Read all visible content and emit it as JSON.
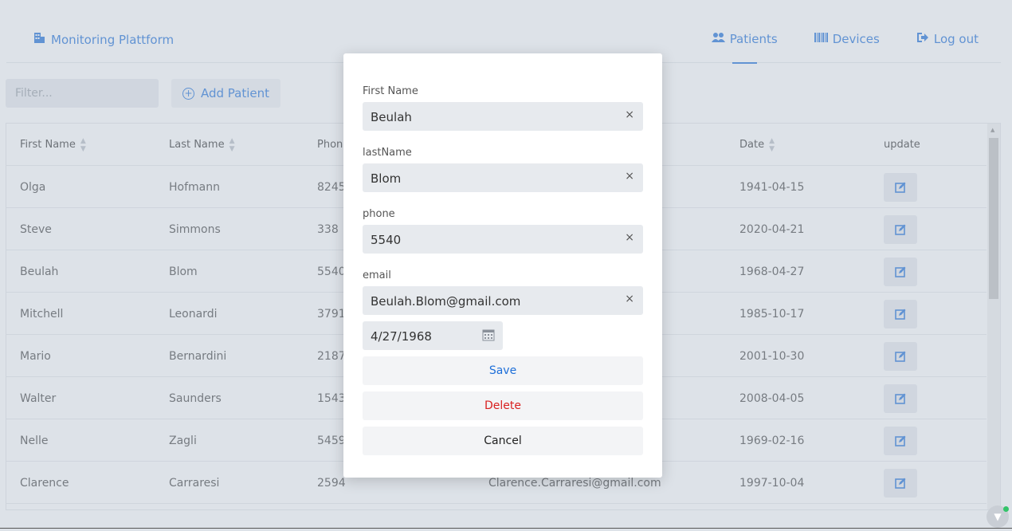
{
  "header": {
    "brand": "Monitoring Plattform",
    "nav": [
      {
        "label": "Patients",
        "icon": "users-icon"
      },
      {
        "label": "Devices",
        "icon": "barcode-icon"
      },
      {
        "label": "Log out",
        "icon": "logout-icon"
      }
    ]
  },
  "toolbar": {
    "filter_placeholder": "Filter...",
    "add_label": "Add Patient"
  },
  "table": {
    "columns": [
      "First Name",
      "Last Name",
      "Phon",
      "Date",
      "update"
    ],
    "rows": [
      {
        "first": "Olga",
        "last": "Hofmann",
        "phone": "8245",
        "date": "1941-04-15"
      },
      {
        "first": "Steve",
        "last": "Simmons",
        "phone": "338",
        "date": "2020-04-21"
      },
      {
        "first": "Beulah",
        "last": "Blom",
        "phone": "5540",
        "date": "1968-04-27"
      },
      {
        "first": "Mitchell",
        "last": "Leonardi",
        "phone": "3791",
        "date": "1985-10-17"
      },
      {
        "first": "Mario",
        "last": "Bernardini",
        "phone": "2187",
        "date": "2001-10-30"
      },
      {
        "first": "Walter",
        "last": "Saunders",
        "phone": "1543",
        "date": "2008-04-05"
      },
      {
        "first": "Nelle",
        "last": "Zagli",
        "phone": "5459",
        "date": "1969-02-16"
      },
      {
        "first": "Clarence",
        "last": "Carraresi",
        "phone": "2594",
        "email": "Clarence.Carraresi@gmail.com",
        "date": "1997-10-04"
      }
    ]
  },
  "modal": {
    "first_label": "First Name",
    "first_value": "Beulah",
    "last_label": "lastName",
    "last_value": "Blom",
    "phone_label": "phone",
    "phone_value": "5540",
    "email_label": "email",
    "email_value": "Beulah.Blom@gmail.com",
    "date_value": "4/27/1968",
    "save": "Save",
    "delete": "Delete",
    "cancel": "Cancel",
    "clear_glyph": "×"
  },
  "colors": {
    "accent": "#1e6fd9",
    "danger": "#d92020"
  }
}
